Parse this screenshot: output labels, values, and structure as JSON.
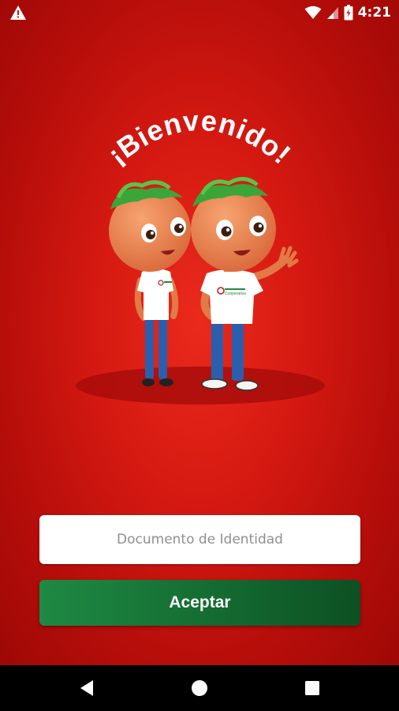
{
  "welcome": {
    "title": "¡Bienvenido!",
    "logo_text": "Cooperativa"
  },
  "form": {
    "document_placeholder": "Documento de Identidad",
    "document_value": "",
    "accept_label": "Aceptar"
  },
  "status_bar": {
    "time": "4:21",
    "icons": [
      "warning-icon",
      "wifi-icon",
      "cell-signal-icon",
      "battery-icon"
    ]
  },
  "navigation": {
    "icons": [
      "back-icon",
      "home-icon",
      "recents-icon"
    ]
  },
  "colors": {
    "background": "#d71a12",
    "button": "#146b31",
    "button_text": "#ffffff"
  }
}
